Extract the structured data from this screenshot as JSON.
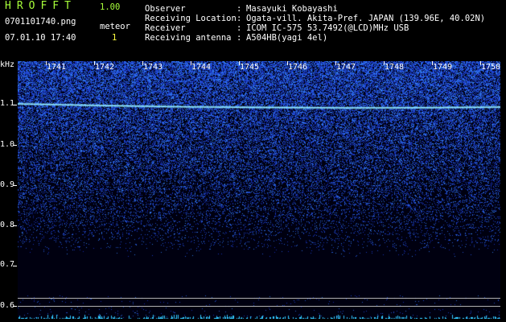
{
  "app": {
    "logo": "HROFFT",
    "version": "1.00"
  },
  "file": {
    "name": "0701101740.png",
    "datetime": "07.01.10 17:40"
  },
  "meteor": {
    "label": "meteor",
    "count": "1"
  },
  "meta": [
    {
      "key": "Observer",
      "value": "Masayuki Kobayashi"
    },
    {
      "key": "Receiving Location",
      "value": "Ogata-vill. Akita-Pref. JAPAN (139.96E, 40.02N)"
    },
    {
      "key": "Receiver",
      "value": "ICOM IC-575 53.7492(@LCD)MHz USB"
    },
    {
      "key": "Receiving antenna",
      "value": "A504HB(yagi 4el)"
    }
  ],
  "axis": {
    "unit": "kHz",
    "freq_labels": [
      "1.1",
      "1.0",
      "0.9",
      "0.8",
      "0.7",
      "0.6"
    ],
    "minute_labels": [
      "1741",
      "1742",
      "1743",
      "1744",
      "1745",
      "1746",
      "1747",
      "1748",
      "1749",
      "1750"
    ]
  },
  "colors": {
    "signal": "#8fe8ff",
    "noise": "#2040ff",
    "background": "#000010"
  }
}
